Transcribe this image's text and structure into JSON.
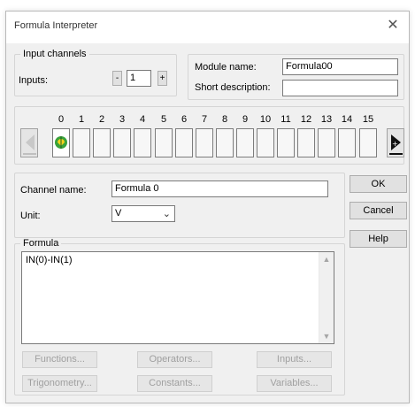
{
  "window": {
    "title": "Formula Interpreter",
    "close_glyph": "✕"
  },
  "input_channels": {
    "group_label": "Input channels",
    "inputs_label": "Inputs:",
    "minus": "-",
    "plus": "+",
    "value": "1"
  },
  "module": {
    "name_label": "Module name:",
    "name_value": "Formula00",
    "desc_label": "Short description:",
    "desc_value": ""
  },
  "channels": {
    "numbers": [
      "0",
      "1",
      "2",
      "3",
      "4",
      "5",
      "6",
      "7",
      "8",
      "9",
      "10",
      "11",
      "12",
      "13",
      "14",
      "15"
    ],
    "active_index": 0,
    "active_icon": "channel-connected-icon"
  },
  "channel": {
    "name_label": "Channel name:",
    "name_value": "Formula 0",
    "unit_label": "Unit:",
    "unit_value": "V"
  },
  "formula": {
    "group_label": "Formula",
    "value": "IN(0)-IN(1)"
  },
  "buttons": {
    "ok": "OK",
    "cancel": "Cancel",
    "help": "Help",
    "functions": "Functions...",
    "operators": "Operators...",
    "inputs": "Inputs...",
    "trigonometry": "Trigonometry...",
    "constants": "Constants...",
    "variables": "Variables..."
  },
  "colors": {
    "accent": "#000000",
    "active_icon_green": "#3aa23a",
    "active_icon_yellow": "#f2d21b"
  }
}
